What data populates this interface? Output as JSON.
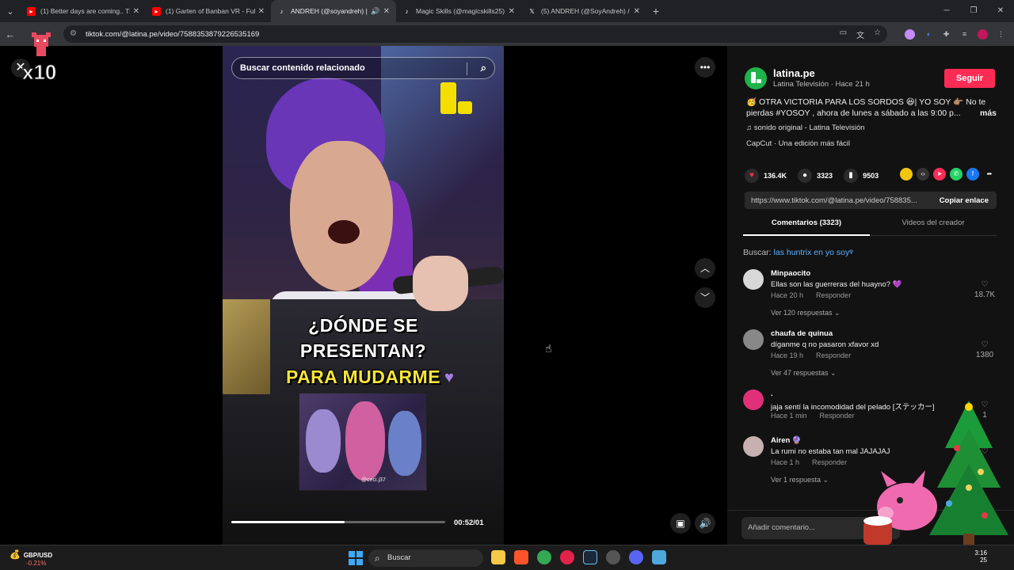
{
  "browser": {
    "tabs": [
      {
        "title": "(1) Better days are coming.. The",
        "favicon": "youtube-icon",
        "active": false
      },
      {
        "title": "(1) Garten of Banban VR - Full G",
        "favicon": "youtube-icon",
        "active": false
      },
      {
        "title": "ANDREH (@soyandreh) | Ti",
        "favicon": "tiktok-icon",
        "active": true
      },
      {
        "title": "Magic Skills (@magicskills25) |",
        "favicon": "tiktok-icon",
        "active": false
      },
      {
        "title": "(5) ANDREH (@SoyAndreh) / X",
        "favicon": "x-icon",
        "active": false
      }
    ],
    "url": "tiktok.com/@latina.pe/video/7588353879226535169"
  },
  "overlay": {
    "x10": "x10"
  },
  "video": {
    "search_placeholder": "Buscar contenido relacionado",
    "caption_line1": "¿DÓNDE SE",
    "caption_line2": "PRESENTAN?",
    "caption_line3": "PARA MUDARME",
    "inset_tag": "@ceci.j37",
    "time": "00:52/01",
    "progress_fraction": 0.53
  },
  "panel": {
    "account_name": "latina.pe",
    "account_meta": "Latina Televisión · Hace 21 h",
    "follow_label": "Seguir",
    "description": "🥳 OTRA VICTORIA PARA LOS SORDOS 😆| YO SOY 👉🏽 No te pierdas #YOSOY , ahora de lunes a sábado a las 9:00 p...",
    "more_label": "más",
    "sound": "♫  sonido original - Latina Televisión",
    "capcut": "CapCut · Una edición más fácil",
    "likes": "136.4K",
    "comments_count": "3323",
    "saves": "9503",
    "link": "https://www.tiktok.com/@latina.pe/video/758835...",
    "copy_label": "Copiar enlace",
    "tab_comments": "Comentarios (3323)",
    "tab_creator_videos": "Videos del creador",
    "suggest_prefix": "Buscar: ",
    "suggest_query": "las huntrix en yo soy",
    "comments": [
      {
        "name": "Minpaocito",
        "text": "Ellas son las guerreras del huayno? 💜",
        "time": "Hace 20 h",
        "reply": "Responder",
        "likes": "18.7K",
        "view": "Ver 120 respuestas ⌄",
        "avatar_color": "#d8d8d8"
      },
      {
        "name": "chaufa de quinua",
        "text": "díganme q no pasaron xfavor xd",
        "time": "Hace 19 h",
        "reply": "Responder",
        "likes": "1380",
        "view": "Ver 47 respuestas ⌄",
        "avatar_color": "#888888"
      },
      {
        "name": ".",
        "text": "jaja sentí la incomodidad del pelado [ステッカー]",
        "time": "Hace 1 min",
        "reply": "Responder",
        "likes": "1",
        "view": "",
        "avatar_color": "#e0307a"
      },
      {
        "name": "Airen 🔮",
        "text": "La rumi no estaba tan mal JAJAJAJ",
        "time": "Hace 1 h",
        "reply": "Responder",
        "likes": "",
        "view": "Ver 1 respuesta ⌄",
        "avatar_color": "#c8b0b0"
      }
    ],
    "add_comment_placeholder": "Añadir comentario..."
  },
  "taskbar": {
    "widget_symbol": "GBP/USD",
    "widget_change": "-0.21%",
    "search_label": "Buscar",
    "clock_line1": "3:16",
    "clock_line2": "25"
  }
}
